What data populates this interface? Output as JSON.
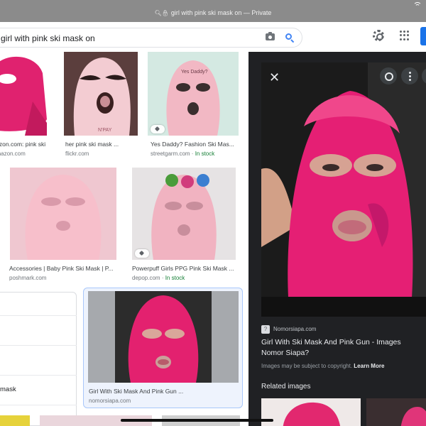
{
  "browser": {
    "url_text": "girl with pink ski mask on — Private"
  },
  "search": {
    "query": "girl with pink ski mask on"
  },
  "results": [
    {
      "caption": "Amazon.com: pink ski ...",
      "source": "amazon.com"
    },
    {
      "caption": "her pink ski mask ...",
      "source": "flickr.com"
    },
    {
      "caption": "Yes Daddy? Fashion Ski Mas...",
      "source": "streetgarm.com",
      "stock": "In stock",
      "print": "Yes Daddy?"
    },
    {
      "caption": "Accessories | Baby Pink Ski Mask | P...",
      "source": "poshmark.com"
    },
    {
      "caption": "Powerpuff Girls PPG Pink Ski Mask ...",
      "source": "depop.com",
      "stock": "In stock"
    },
    {
      "caption": "Girl With Ski Mask And Pink Gun ...",
      "source": "nomorsiapa.com"
    }
  ],
  "related_searches_card": {
    "last_label": "mask"
  },
  "preview": {
    "site": "Nomorsiapa.com",
    "favicon_text": "?",
    "title": "Girl With Ski Mask And Pink Gun - Images Nomor Siapa?",
    "copyright_text": "Images may be subject to copyright.",
    "learn_more": "Learn More",
    "related_heading": "Related images"
  },
  "colors": {
    "mask_pink": "#e91e78",
    "light_pink": "#f4b6c8",
    "in_stock_green": "#188038",
    "panel_bg": "#202124",
    "link_blue": "#4285f4"
  },
  "icons": [
    "lock-icon",
    "wifi-icon",
    "camera-icon",
    "search-icon",
    "settings-gear-icon",
    "apps-grid-icon",
    "tag-icon",
    "close-icon",
    "lens-icon",
    "more-vert-icon"
  ]
}
